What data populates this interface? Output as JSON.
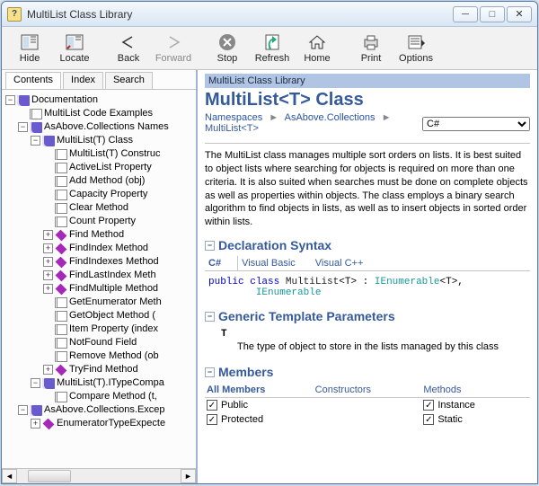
{
  "window": {
    "title": "MultiList Class Library"
  },
  "toolbar": {
    "hide": "Hide",
    "locate": "Locate",
    "back": "Back",
    "forward": "Forward",
    "stop": "Stop",
    "refresh": "Refresh",
    "home": "Home",
    "print": "Print",
    "options": "Options"
  },
  "tabs": {
    "contents": "Contents",
    "index": "Index",
    "search": "Search"
  },
  "tree": {
    "root": "Documentation",
    "codeExamples": "MultiList Code Examples",
    "ns": "AsAbove.Collections Names",
    "cls": "MultiList(T) Class",
    "members": [
      "MultiList(T) Construc",
      "ActiveList Property",
      "Add Method (obj)",
      "Capacity Property",
      "Clear Method",
      "Count Property"
    ],
    "diamonds": [
      "Find Method",
      "FindIndex Method",
      "FindIndexes Method",
      "FindLastIndex Meth",
      "FindMultiple Method"
    ],
    "more": [
      "GetEnumerator Meth",
      "GetObject Method (",
      "Item Property (index",
      "NotFound Field",
      "Remove Method (ob"
    ],
    "tryfind": "TryFind Method",
    "typecompa": "MultiList(T).ITypeCompa",
    "compare": "Compare Method (t,",
    "excep": "AsAbove.Collections.Excep",
    "enumType": "EnumeratorTypeExpecte"
  },
  "content": {
    "toplabel": "MultiList Class Library",
    "title": "MultiList<T> Class",
    "crumb": {
      "ns": "Namespaces",
      "col": "AsAbove.Collections",
      "cls": "MultiList<T>"
    },
    "lang_selected": "C#",
    "desc": "The MultiList class manages multiple sort orders on lists. It is best suited to object lists where searching for objects is required on more than one criteria. It is also suited when searches must be done on complete objects as well as properties within objects. The class employs a binary search algorithm to find objects in lists, as well as to insert objects in sorted order within lists.",
    "sect_decl": "Declaration Syntax",
    "langtabs": {
      "cs": "C#",
      "vb": "Visual Basic",
      "vc": "Visual C++"
    },
    "code": {
      "k_public": "public",
      "k_class": "class",
      "name": "MultiList",
      "ienum_t": "IEnumerable",
      "ienum": "IEnumerable"
    },
    "sect_params": "Generic Template Parameters",
    "param": {
      "name": "T",
      "desc": "The type of object to store in the lists managed by this class"
    },
    "sect_members": "Members",
    "mheaders": {
      "all": "All Members",
      "ctor": "Constructors",
      "methods": "Methods"
    },
    "mfilters": {
      "public": "Public",
      "protected": "Protected",
      "instance": "Instance",
      "static": "Static"
    }
  }
}
